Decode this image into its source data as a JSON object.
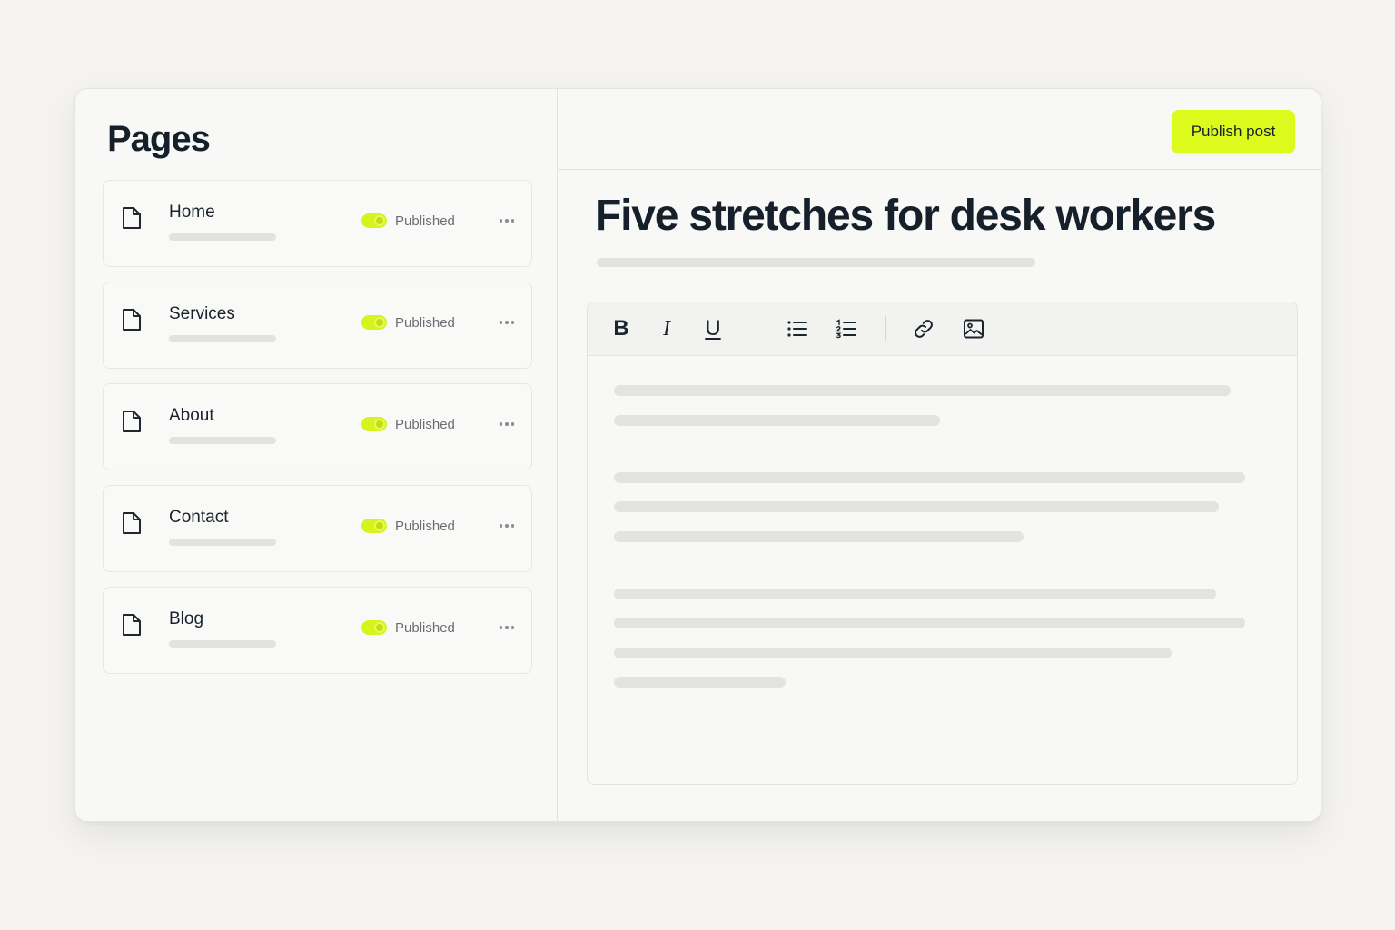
{
  "sidebar": {
    "title": "Pages",
    "pages": [
      {
        "name": "Home",
        "status": "Published"
      },
      {
        "name": "Services",
        "status": "Published"
      },
      {
        "name": "About",
        "status": "Published"
      },
      {
        "name": "Contact",
        "status": "Published"
      },
      {
        "name": "Blog",
        "status": "Published"
      }
    ]
  },
  "header": {
    "publish_label": "Publish post"
  },
  "editor": {
    "title": "Five stretches for desk workers",
    "toolbar": {
      "bold": "B",
      "italic": "I",
      "underline": "U"
    }
  },
  "colors": {
    "accent": "#dcfa1c",
    "toggle_on": "#d6f41c",
    "background": "#f4f3f1",
    "text": "#16202a"
  }
}
